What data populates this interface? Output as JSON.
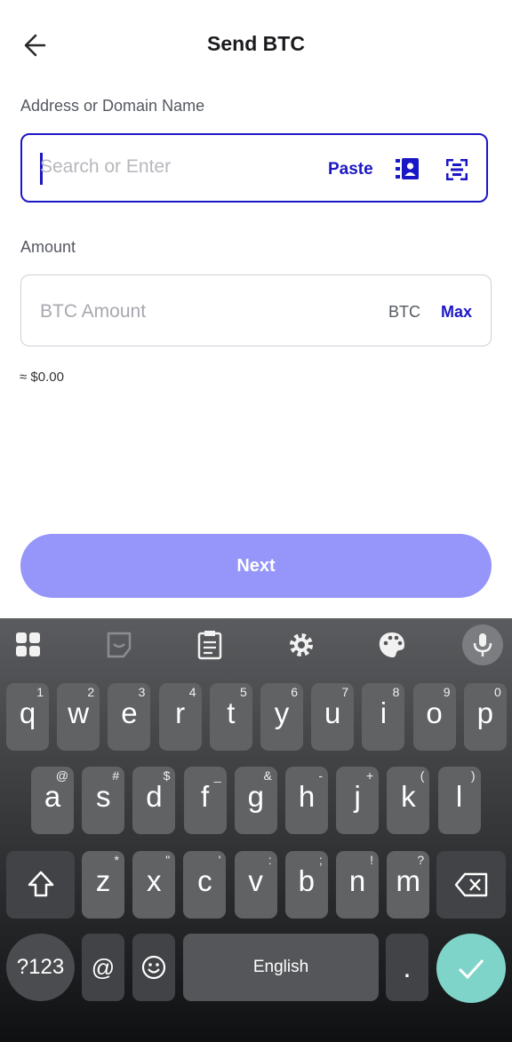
{
  "header": {
    "title": "Send BTC"
  },
  "address": {
    "label": "Address or Domain Name",
    "placeholder": "Search or Enter",
    "paste_label": "Paste"
  },
  "amount": {
    "label": "Amount",
    "placeholder": "BTC Amount",
    "unit": "BTC",
    "max_label": "Max",
    "fiat_estimate": "≈ $0.00"
  },
  "next_label": "Next",
  "colors": {
    "accent": "#1c17c5",
    "button": "#9595fa",
    "enter": "#7fd4c9"
  },
  "keyboard": {
    "toolbar_icons": [
      "apps-grid-icon",
      "sticker-icon",
      "clipboard-icon",
      "settings-gear-icon",
      "palette-icon",
      "microphone-icon"
    ],
    "row1": [
      {
        "k": "q",
        "h": "1"
      },
      {
        "k": "w",
        "h": "2"
      },
      {
        "k": "e",
        "h": "3"
      },
      {
        "k": "r",
        "h": "4"
      },
      {
        "k": "t",
        "h": "5"
      },
      {
        "k": "y",
        "h": "6"
      },
      {
        "k": "u",
        "h": "7"
      },
      {
        "k": "i",
        "h": "8"
      },
      {
        "k": "o",
        "h": "9"
      },
      {
        "k": "p",
        "h": "0"
      }
    ],
    "row2": [
      {
        "k": "a",
        "h": "@"
      },
      {
        "k": "s",
        "h": "#"
      },
      {
        "k": "d",
        "h": "$"
      },
      {
        "k": "f",
        "h": "_"
      },
      {
        "k": "g",
        "h": "&"
      },
      {
        "k": "h",
        "h": "-"
      },
      {
        "k": "j",
        "h": "+"
      },
      {
        "k": "k",
        "h": "("
      },
      {
        "k": "l",
        "h": ")"
      }
    ],
    "row3": [
      {
        "k": "z",
        "h": "*"
      },
      {
        "k": "x",
        "h": "\""
      },
      {
        "k": "c",
        "h": "'"
      },
      {
        "k": "v",
        "h": ":"
      },
      {
        "k": "b",
        "h": ";"
      },
      {
        "k": "n",
        "h": "!"
      },
      {
        "k": "m",
        "h": "?"
      }
    ],
    "mode_label": "?123",
    "at_label": "@",
    "space_label": "English",
    "period_label": "."
  }
}
